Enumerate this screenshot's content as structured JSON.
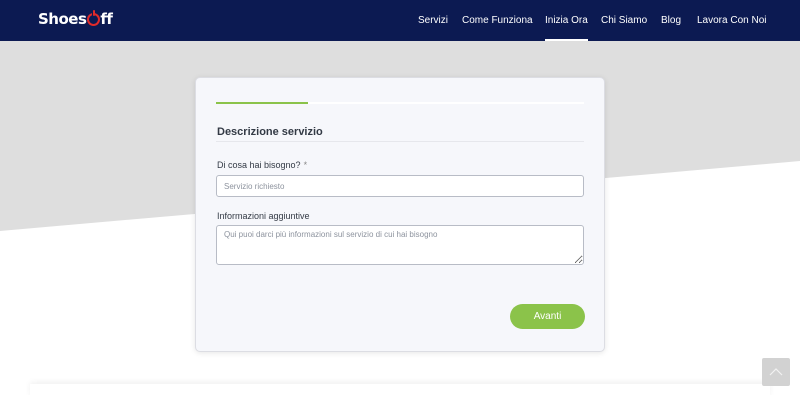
{
  "brand": {
    "logo_prefix": "Shoes",
    "logo_suffix": "ff",
    "logo_accent_color": "#e02a2a",
    "navbar_color": "#0c1a52"
  },
  "nav": {
    "items": [
      {
        "label": "Servizi"
      },
      {
        "label": "Come Funziona"
      },
      {
        "label": "Inizia Ora",
        "active": true
      },
      {
        "label": "Chi Siamo"
      },
      {
        "label": "Blog"
      },
      {
        "label": "Lavora Con Noi"
      }
    ]
  },
  "form": {
    "progress_fraction": 0.25,
    "progress_color": "#8bc34a",
    "section_title": "Descrizione servizio",
    "need": {
      "label": "Di cosa hai bisogno?",
      "required_mark": "*",
      "placeholder": "Servizio richiesto",
      "value": ""
    },
    "info": {
      "label": "Informazioni aggiuntive",
      "placeholder": "Qui puoi darci più informazioni sul servizio di cui hai bisogno",
      "value": ""
    },
    "next_button": "Avanti"
  },
  "scroll_top": {
    "icon": "chevron-up-icon"
  }
}
